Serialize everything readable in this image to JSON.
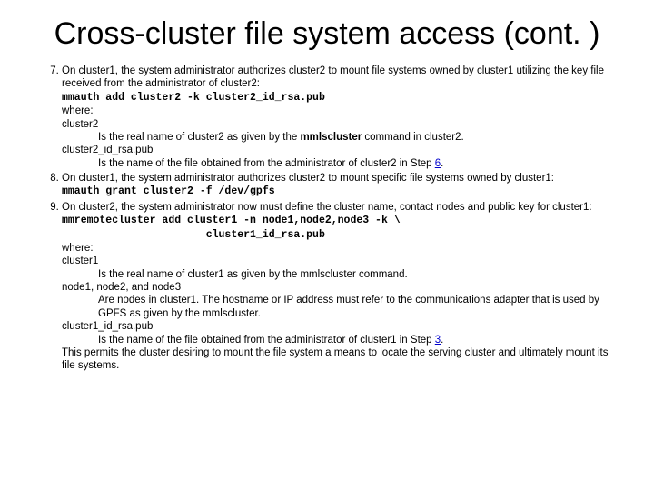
{
  "title": "Cross-cluster file system access (cont. )",
  "start_number": 7,
  "items": [
    {
      "intro": "On cluster1, the system administrator authorizes cluster2 to mount file systems owned by cluster1 utilizing the key file received from the administrator of cluster2:",
      "command": "mmauth add cluster2 -k cluster2_id_rsa.pub",
      "where_label": "where:",
      "defs": [
        {
          "term": "cluster2",
          "text_a": "Is the real name of cluster2 as given by the ",
          "bold": "mmlscluster",
          "text_b": " command in cluster2."
        },
        {
          "term": "cluster2_id_rsa.pub",
          "text_a": "Is the name of the file obtained from the administrator of cluster2 in Step ",
          "link": "6",
          "text_b": "."
        }
      ]
    },
    {
      "intro": "On cluster1, the system administrator authorizes cluster2 to mount specific file systems owned by cluster1:",
      "command": "mmauth grant cluster2 -f /dev/gpfs"
    },
    {
      "intro": "On cluster2, the system administrator now must define the cluster name, contact nodes and public key for cluster1:",
      "command": "mmremotecluster add cluster1 -n node1,node2,node3 -k \\",
      "command2": "                       cluster1_id_rsa.pub",
      "where_label": "where:",
      "defs": [
        {
          "term": "cluster1",
          "text_a": "Is the real name of cluster1 as given by the mmlscluster command."
        },
        {
          "term": "node1, node2, and node3",
          "text_a": "Are nodes in cluster1. The hostname or IP address must refer to the communications adapter that is used by GPFS as given by the mmlscluster."
        },
        {
          "term": "cluster1_id_rsa.pub",
          "text_a": "Is the name of the file obtained from the administrator of cluster1 in Step ",
          "link": "3",
          "text_b": "."
        }
      ],
      "trailing": "This permits the cluster desiring to mount the file system a means to locate the serving cluster and ultimately mount its file systems."
    }
  ]
}
